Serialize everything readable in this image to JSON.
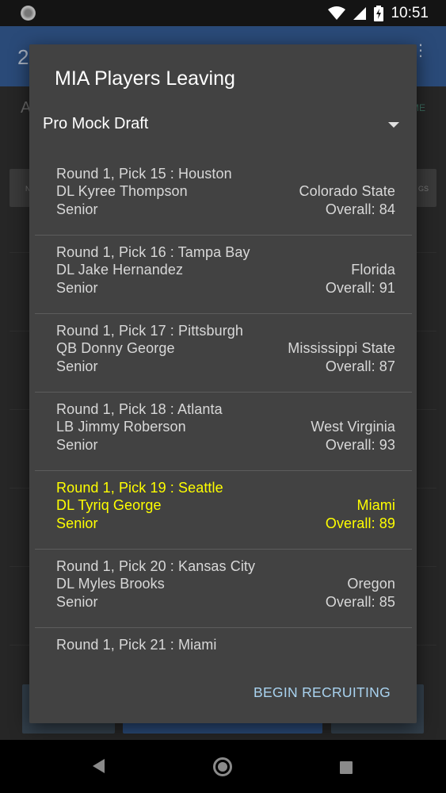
{
  "status_bar": {
    "time": "10:51",
    "icons": [
      "notification-dot-icon",
      "wifi-icon",
      "cell-signal-icon",
      "battery-charging-icon"
    ]
  },
  "background": {
    "title_partial": "2",
    "subtitle_partial": "A",
    "right_partial": "ME",
    "header_left": "N",
    "header_right": "GS"
  },
  "dialog": {
    "title": "MIA Players Leaving",
    "spinner": {
      "selected": "Pro Mock Draft"
    },
    "picks": [
      {
        "pick": "Round 1, Pick 15 : Houston",
        "player": "DL Kyree Thompson",
        "school": "Colorado State",
        "year": "Senior",
        "overall": "Overall: 84",
        "highlight": false
      },
      {
        "pick": "Round 1, Pick 16 : Tampa Bay",
        "player": "DL Jake Hernandez",
        "school": "Florida",
        "year": "Senior",
        "overall": "Overall: 91",
        "highlight": false
      },
      {
        "pick": "Round 1, Pick 17 : Pittsburgh",
        "player": "QB Donny George",
        "school": "Mississippi State",
        "year": "Senior",
        "overall": "Overall: 87",
        "highlight": false
      },
      {
        "pick": "Round 1, Pick 18 : Atlanta",
        "player": "LB Jimmy Roberson",
        "school": "West Virginia",
        "year": "Senior",
        "overall": "Overall: 93",
        "highlight": false
      },
      {
        "pick": "Round 1, Pick 19 : Seattle",
        "player": "DL Tyriq George",
        "school": "Miami",
        "year": "Senior",
        "overall": "Overall: 89",
        "highlight": true
      },
      {
        "pick": "Round 1, Pick 20 : Kansas City",
        "player": "DL Myles Brooks",
        "school": "Oregon",
        "year": "Senior",
        "overall": "Overall: 85",
        "highlight": false
      },
      {
        "pick": "Round 1, Pick 21 : Miami",
        "player": "",
        "school": "",
        "year": "",
        "overall": "",
        "highlight": false
      }
    ],
    "action_label": "BEGIN RECRUITING"
  },
  "colors": {
    "dialog_bg": "#424242",
    "highlight": "#ffff00",
    "text": "#d8d8d8",
    "action": "#a9d3f0",
    "app_bar": "#2a4a78"
  },
  "nav_bar": {
    "icons": [
      "back-icon",
      "home-icon",
      "recent-apps-icon"
    ]
  }
}
